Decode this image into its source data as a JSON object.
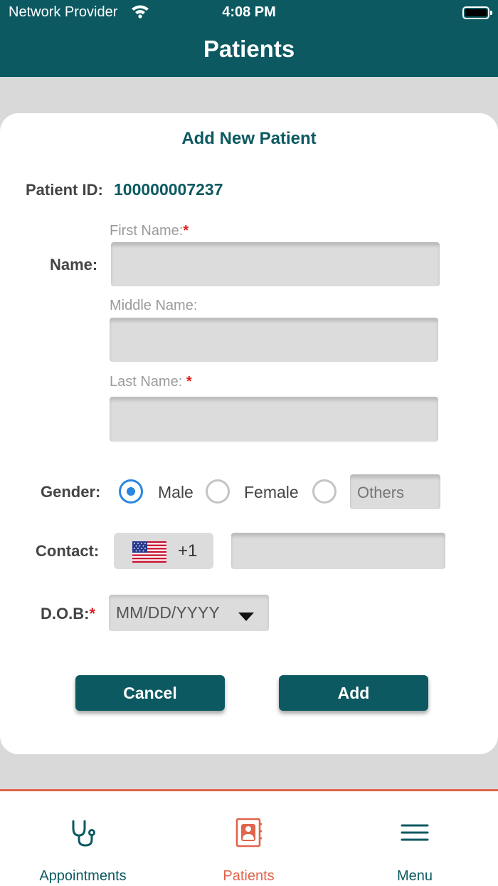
{
  "status_bar": {
    "carrier": "Network Provider",
    "time": "4:08 PM"
  },
  "header": {
    "title": "Patients"
  },
  "form": {
    "title": "Add New Patient",
    "patient_id_label": "Patient ID:",
    "patient_id_value": "100000007237",
    "name_label": "Name:",
    "first_name_label": "First Name:",
    "middle_name_label": "Middle Name:",
    "last_name_label": "Last Name:",
    "required_mark": "*",
    "first_name_value": "",
    "middle_name_value": "",
    "last_name_value": "",
    "gender_label": "Gender:",
    "gender_options": [
      "Male",
      "Female"
    ],
    "gender_selected": "Male",
    "others_placeholder": "Others",
    "contact_label": "Contact:",
    "country_code": "+1",
    "country_flag": "us-flag-icon",
    "phone_value": "",
    "dob_label": "D.O.B:",
    "dob_placeholder": "MM/DD/YYYY",
    "cancel_label": "Cancel",
    "add_label": "Add"
  },
  "tabs": [
    {
      "label": "Appointments",
      "icon": "stethoscope-icon",
      "active": false
    },
    {
      "label": "Patients",
      "icon": "patient-contact-icon",
      "active": true
    },
    {
      "label": "Menu",
      "icon": "hamburger-menu-icon",
      "active": false
    }
  ],
  "colors": {
    "primary": "#0c5961",
    "accent": "#e0654a",
    "radio": "#2a86e0",
    "required": "#e0201c"
  }
}
